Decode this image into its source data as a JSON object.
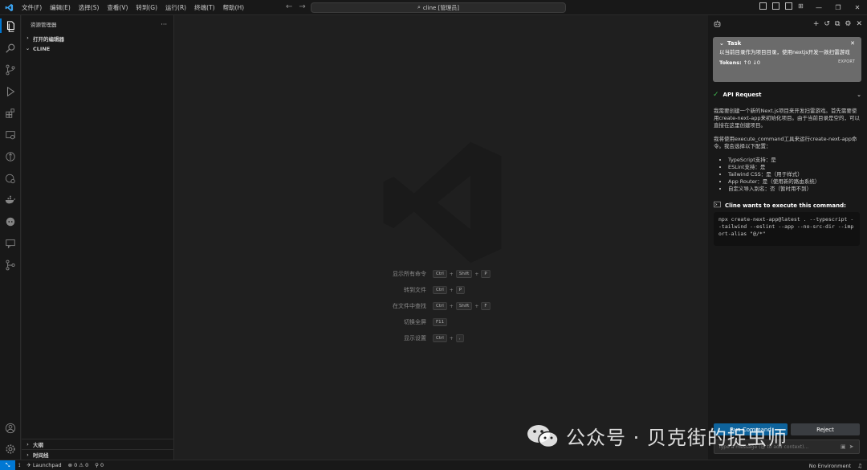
{
  "titlebar": {
    "menu": [
      "文件(F)",
      "编辑(E)",
      "选择(S)",
      "查看(V)",
      "转到(G)",
      "运行(R)",
      "终端(T)",
      "帮助(H)"
    ],
    "command_center": "cline [管理员]"
  },
  "activitybar": {
    "icons": [
      "explorer-icon",
      "search-icon",
      "source-control-icon",
      "run-debug-icon",
      "extensions-icon",
      "remote-explorer-icon",
      "timeline-icon",
      "testing-icon",
      "docker-icon",
      "cline-icon",
      "chat-icon",
      "git-graph-icon"
    ],
    "bottom_icons": [
      "account-icon",
      "settings-gear-icon"
    ]
  },
  "sidebar": {
    "title": "资源管理器",
    "more": "···",
    "sections": [
      "打开的编辑器",
      "CLINE"
    ],
    "bottom_sections": [
      "大纲",
      "时间线"
    ]
  },
  "editor": {
    "shortcuts": [
      {
        "label": "显示所有命令",
        "keys": [
          "Ctrl",
          "Shift",
          "P"
        ]
      },
      {
        "label": "转到文件",
        "keys": [
          "Ctrl",
          "P"
        ]
      },
      {
        "label": "在文件中查找",
        "keys": [
          "Ctrl",
          "Shift",
          "F"
        ]
      },
      {
        "label": "切换全屏",
        "keys": [
          "F11"
        ]
      },
      {
        "label": "显示设置",
        "keys": [
          "Ctrl",
          ","
        ]
      }
    ]
  },
  "cline": {
    "task": {
      "title": "Task",
      "text": "以当前目录作为项目目录，使用nextjs开发一款扫雷游戏",
      "tokens_label": "Tokens:",
      "tokens_up": "0",
      "tokens_down": "0",
      "export": "EXPORT"
    },
    "api_request": "API Request",
    "message_p1": "我需要创建一个新的Next.js项目来开发扫雷游戏。首先需要使用create-next-app来初始化项目。由于当前目录是空的，可以直接在这里创建项目。",
    "message_p2": "我将使用execute_command工具来运行create-next-app命令。我会选择以下配置：",
    "bullets": [
      "TypeScript支持：是",
      "ESLint支持：是",
      "Tailwind CSS：是（用于样式）",
      "App Router：是（使用新的路由系统）",
      "自定义导入别名：否（暂时用不到）"
    ],
    "command_title": "Cline wants to execute this command:",
    "command": "npx create-next-app@latest . --typescript --tailwind --eslint --app --no-src-dir --import-alias \"@/*\"",
    "run_button": "Run Command",
    "reject_button": "Reject",
    "input_placeholder": "Type a message (@ to add context)..."
  },
  "statusbar": {
    "launchpad": "Launchpad",
    "errors": "0",
    "warnings": "0",
    "ports": "0",
    "environment": "No Environment"
  },
  "watermark": "公众号 · 贝克街的捉虫师",
  "colors": {
    "accent": "#0078d4",
    "run_button": "#0e639c",
    "task_card": "#6b6b6b",
    "success": "#3fb950"
  }
}
